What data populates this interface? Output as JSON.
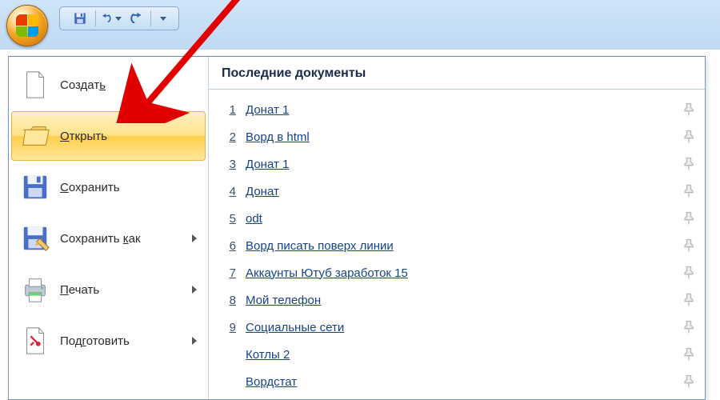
{
  "qat": {
    "save_title": "Сохранить",
    "undo_title": "Отменить",
    "redo_title": "Повторить"
  },
  "menu": {
    "create": {
      "label": "Создать",
      "u_index": 6
    },
    "open": {
      "label": "Открыть",
      "u_index": 0
    },
    "save": {
      "label": "Сохранить",
      "u_index": 0
    },
    "save_as": {
      "label": "Сохранить как",
      "u_index": 10
    },
    "print": {
      "label": "Печать",
      "u_index": 0
    },
    "prepare": {
      "label": "Подготовить",
      "u_index": 3
    }
  },
  "recent": {
    "header": "Последние документы",
    "docs": [
      {
        "n": "1",
        "name": "Донат 1"
      },
      {
        "n": "2",
        "name": "Ворд в html"
      },
      {
        "n": "3",
        "name": "Донат 1"
      },
      {
        "n": "4",
        "name": "Донат"
      },
      {
        "n": "5",
        "name": "odt"
      },
      {
        "n": "6",
        "name": "Ворд писать поверх линии"
      },
      {
        "n": "7",
        "name": "Аккаунты Ютуб заработок 15"
      },
      {
        "n": "8",
        "name": "Мой телефон"
      },
      {
        "n": "9",
        "name": "Социальные сети"
      },
      {
        "n": "",
        "name": "Котлы 2"
      },
      {
        "n": "",
        "name": "Вордстат"
      }
    ]
  }
}
